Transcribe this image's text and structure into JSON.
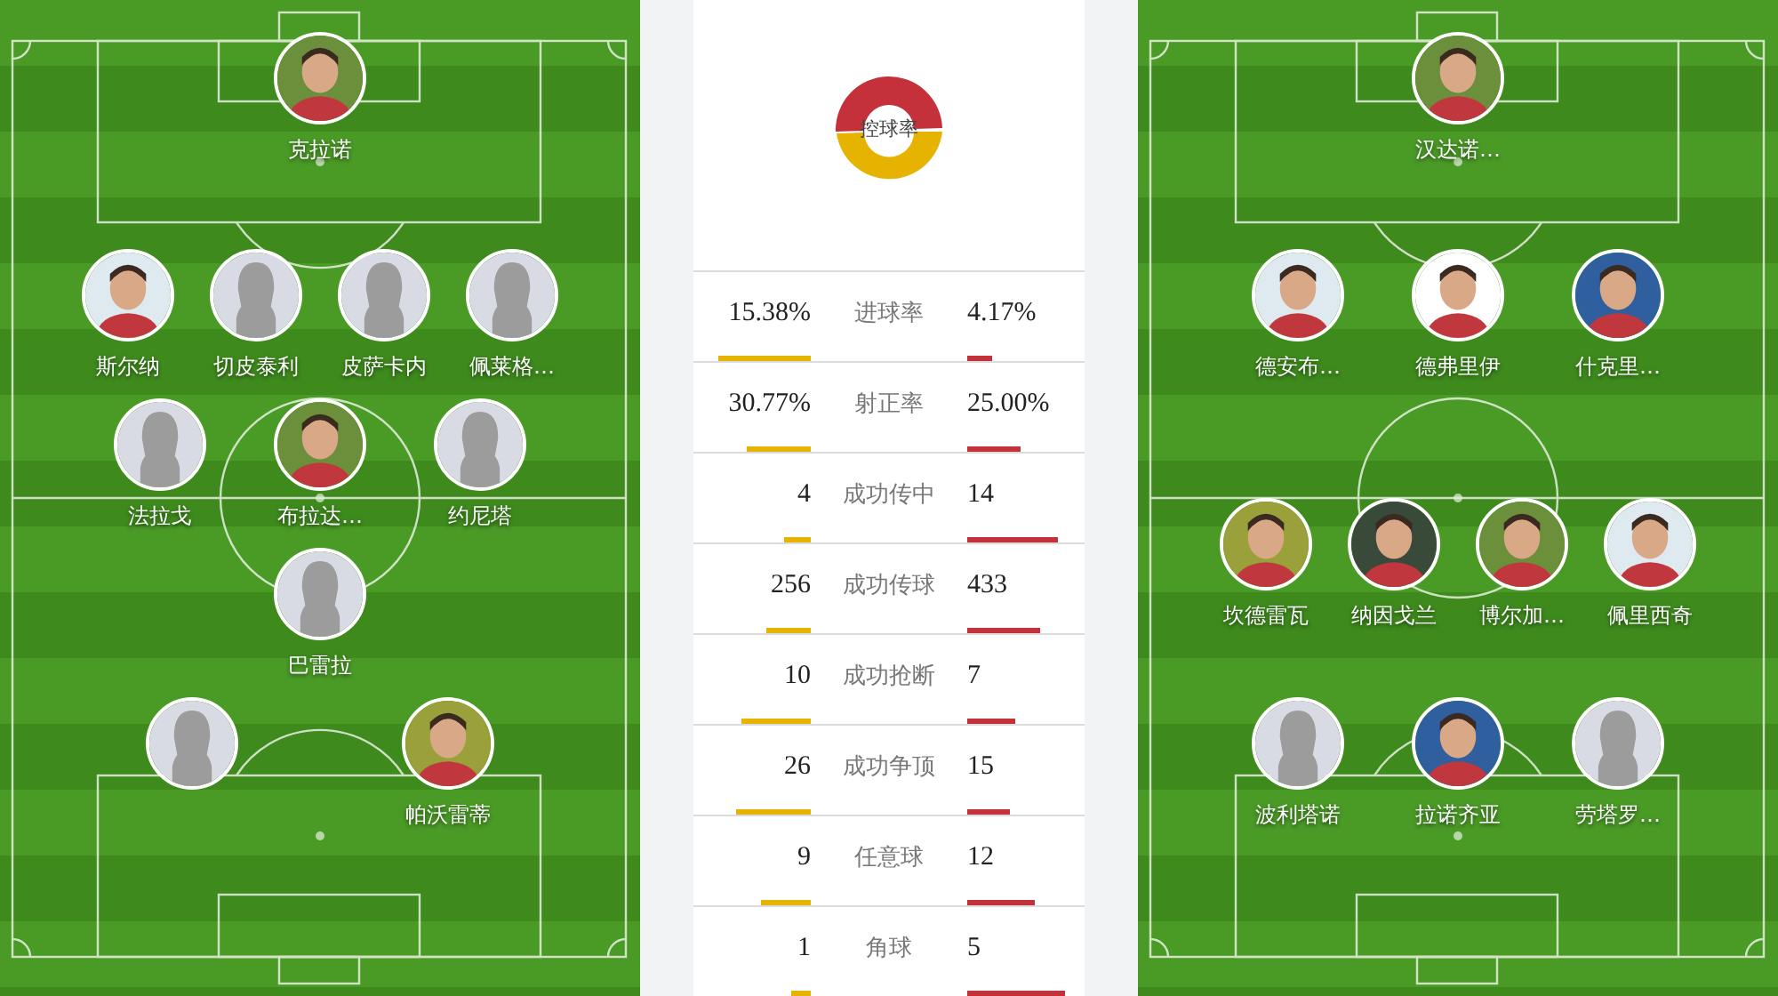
{
  "home": {
    "lines": [
      [
        {
          "name": "克拉诺"
        }
      ],
      [
        {
          "name": "斯尔纳"
        },
        {
          "name": "切皮泰利",
          "kind": "placeholder"
        },
        {
          "name": "皮萨卡内",
          "kind": "placeholder"
        },
        {
          "name": "佩莱格…",
          "kind": "placeholder"
        }
      ],
      [
        {
          "name": "法拉戈",
          "kind": "placeholder"
        },
        {
          "name": "布拉达…"
        },
        {
          "name": "约尼塔",
          "kind": "placeholder"
        }
      ],
      [
        {
          "name": "巴雷拉",
          "kind": "placeholder"
        }
      ],
      [
        {
          "kind": "placeholder"
        },
        {
          "name": "帕沃雷蒂"
        }
      ]
    ]
  },
  "stats": {
    "possession_label": "控球率",
    "rows": [
      {
        "label": "进球率",
        "home": "15.38%",
        "away": "4.17%"
      },
      {
        "label": "射正率",
        "home": "30.77%",
        "away": "25.00%"
      },
      {
        "label": "成功传中",
        "home": "4",
        "away": "14"
      },
      {
        "label": "成功传球",
        "home": "256",
        "away": "433"
      },
      {
        "label": "成功抢断",
        "home": "10",
        "away": "7"
      },
      {
        "label": "成功争顶",
        "home": "26",
        "away": "15"
      },
      {
        "label": "任意球",
        "home": "9",
        "away": "12"
      },
      {
        "label": "角球",
        "home": "1",
        "away": "5"
      }
    ]
  },
  "away": {
    "lines": [
      [
        {
          "name": "汉达诺…"
        }
      ],
      [
        {
          "name": "德安布…"
        },
        {
          "name": "德弗里伊"
        },
        {
          "name": "什克里…"
        }
      ],
      [
        {
          "name": "坎德雷瓦"
        },
        {
          "name": "纳因戈兰"
        },
        {
          "name": "博尔加…"
        },
        {
          "name": "佩里西奇"
        }
      ],
      [
        {
          "name": "波利塔诺",
          "kind": "placeholder"
        },
        {
          "name": "拉诺齐亚"
        },
        {
          "name": "劳塔罗…",
          "kind": "placeholder"
        }
      ]
    ]
  }
}
